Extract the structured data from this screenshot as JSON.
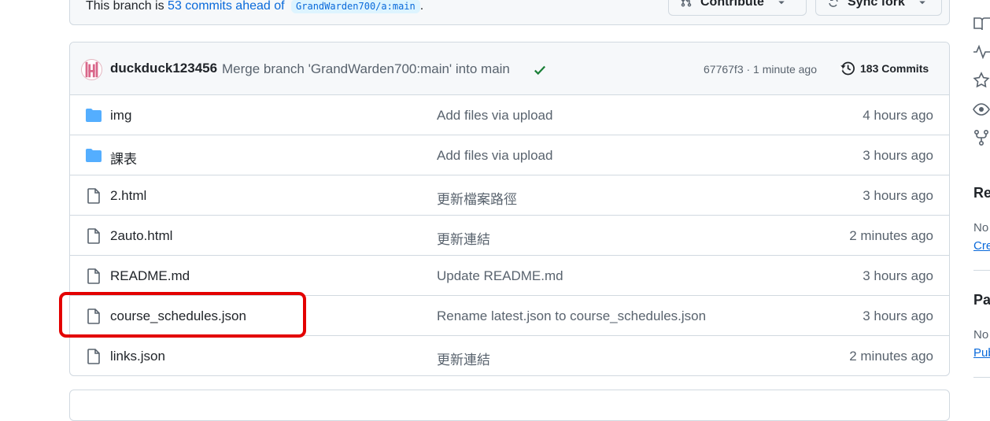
{
  "top": {
    "ahead_prefix": "This branch is",
    "ahead_link": "53 commits ahead of",
    "branch": "GrandWarden700/a:main",
    "ahead_suffix": ".",
    "contribute_label": "Contribute",
    "sync_label": "Sync fork"
  },
  "commit": {
    "author": "duckduck123456",
    "message": "Merge branch 'GrandWarden700:main' into main",
    "meta": "67767f3 · 1 minute ago",
    "commits_label": "183 Commits"
  },
  "files": [
    {
      "type": "folder",
      "name": "img",
      "message": "Add files via upload",
      "time": "4 hours ago"
    },
    {
      "type": "folder",
      "name": "課表",
      "message": "Add files via upload",
      "time": "3 hours ago"
    },
    {
      "type": "file",
      "name": "2.html",
      "message": "更新檔案路徑",
      "time": "3 hours ago"
    },
    {
      "type": "file",
      "name": "2auto.html",
      "message": "更新連結",
      "time": "2 minutes ago"
    },
    {
      "type": "file",
      "name": "README.md",
      "message": "Update README.md",
      "time": "3 hours ago"
    },
    {
      "type": "file",
      "name": "course_schedules.json",
      "message": "Rename latest.json to course_schedules.json",
      "time": "3 hours ago"
    },
    {
      "type": "file",
      "name": "links.json",
      "message": "更新連結",
      "time": "2 minutes ago"
    }
  ],
  "sidebar": {
    "heading_1": "Re",
    "text_1": "No",
    "link_1": "Cre",
    "heading_2": "Pa",
    "text_2": "No",
    "link_2": "Pub"
  },
  "colors": {
    "link": "#0969da",
    "folder": "#54aeff",
    "highlight": "#e30000",
    "success": "#1a7f37"
  }
}
